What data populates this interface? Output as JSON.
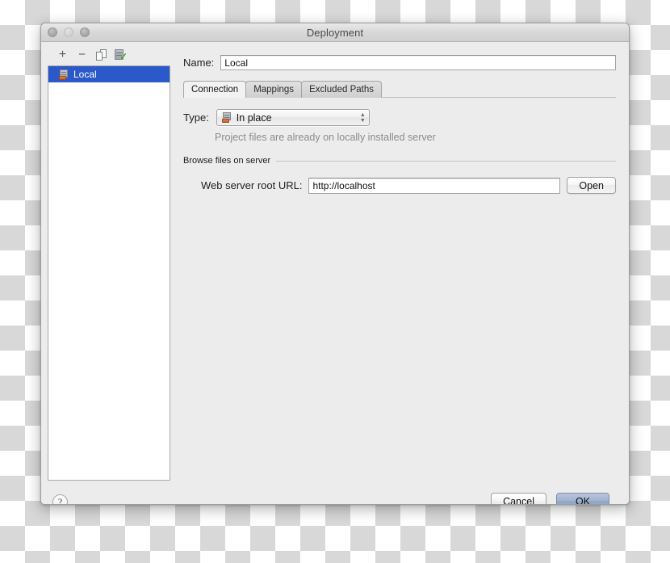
{
  "window": {
    "title": "Deployment",
    "traffic_lights": [
      "close",
      "minimize",
      "zoom"
    ]
  },
  "sidebar": {
    "toolbar": [
      {
        "name": "add-server-button",
        "glyph": "+"
      },
      {
        "name": "remove-server-button",
        "glyph": "−"
      },
      {
        "name": "duplicate-server-button",
        "glyph": ""
      },
      {
        "name": "set-default-server-button",
        "glyph": ""
      }
    ],
    "items": [
      {
        "label": "Local",
        "selected": true
      }
    ]
  },
  "form": {
    "name_label": "Name:",
    "name_value": "Local",
    "type_label": "Type:",
    "type_value": "In place",
    "type_hint": "Project files are already on locally installed server",
    "group_title": "Browse files on server",
    "url_label": "Web server root URL:",
    "url_value": "http://localhost",
    "open_label": "Open"
  },
  "tabs": [
    {
      "label": "Connection",
      "active": true
    },
    {
      "label": "Mappings",
      "active": false
    },
    {
      "label": "Excluded Paths",
      "active": false
    }
  ],
  "footer": {
    "help_label": "?",
    "cancel_label": "Cancel",
    "ok_label": "OK"
  },
  "colors": {
    "selection_blue": "#2b59c9",
    "default_button_blue": "#9fb2cf",
    "dialog_bg": "#ececec",
    "hint_gray": "#8b8b8b"
  }
}
